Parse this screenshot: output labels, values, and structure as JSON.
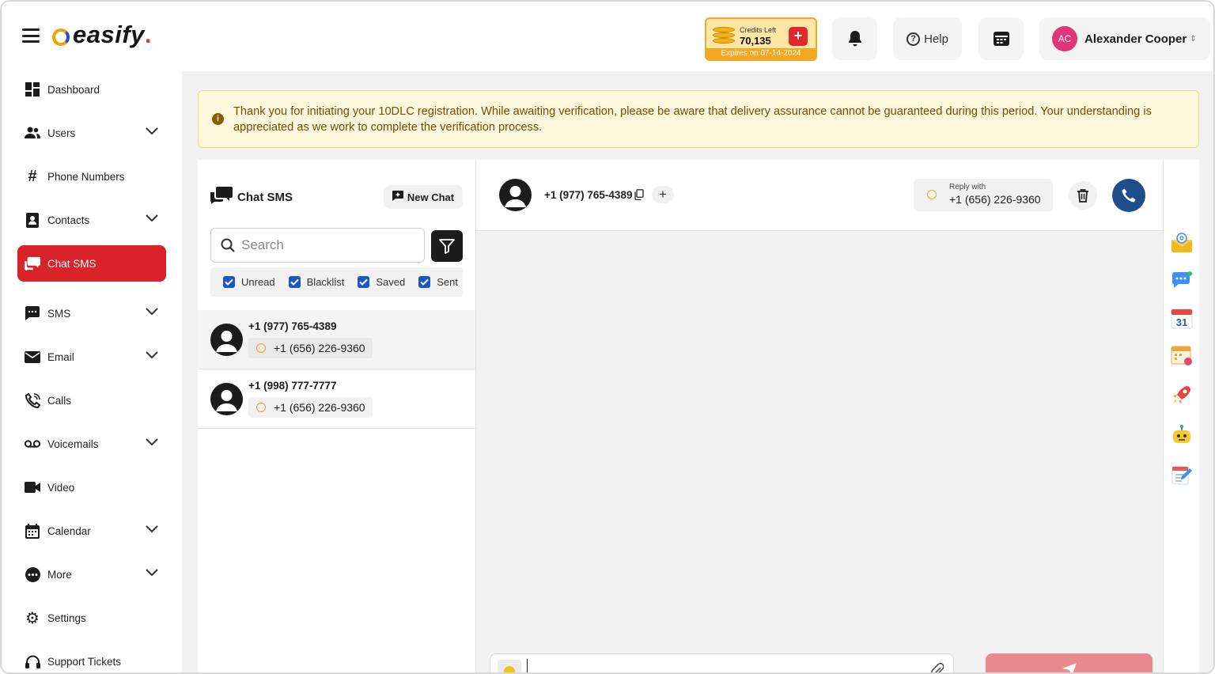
{
  "header": {
    "logo_text": "easify",
    "logo_dot": ".",
    "credits": {
      "label": "Credits Left",
      "value": "70,135",
      "expires": "Expires on 07-14-2024",
      "add": "+"
    },
    "help_label": "Help",
    "help_q": "?",
    "user": {
      "initials": "AC",
      "name": "Alexander Cooper"
    }
  },
  "sidebar": {
    "items": [
      {
        "label": "Dashboard",
        "icon": "dashboard-icon",
        "expandable": false
      },
      {
        "label": "Users",
        "icon": "users-icon",
        "expandable": true
      },
      {
        "label": "Phone Numbers",
        "icon": "hash-icon",
        "expandable": false
      },
      {
        "label": "Contacts",
        "icon": "contacts-icon",
        "expandable": true
      },
      {
        "label": "Chat SMS",
        "icon": "chat-icon",
        "expandable": false,
        "active": true
      },
      {
        "label": "SMS",
        "icon": "sms-icon",
        "expandable": true
      },
      {
        "label": "Email",
        "icon": "email-icon",
        "expandable": true
      },
      {
        "label": "Calls",
        "icon": "phone-icon",
        "expandable": false
      },
      {
        "label": "Voicemails",
        "icon": "voicemail-icon",
        "expandable": true
      },
      {
        "label": "Video",
        "icon": "video-icon",
        "expandable": false
      },
      {
        "label": "Calendar",
        "icon": "calendar-icon",
        "expandable": true
      },
      {
        "label": "More",
        "icon": "more-icon",
        "expandable": true
      },
      {
        "label": "Settings",
        "icon": "gear-icon",
        "expandable": false
      },
      {
        "label": "Support Tickets",
        "icon": "headset-icon",
        "expandable": false
      }
    ]
  },
  "banner": {
    "info": "i",
    "message": "Thank you for initiating your 10DLC registration. While awaiting verification, please be aware that delivery assurance cannot be guaranteed during this period. Your understanding is appreciated as we work to complete the verification process."
  },
  "chat_list": {
    "title": "Chat SMS",
    "new_chat_label": "New Chat",
    "search_placeholder": "Search",
    "filters": [
      {
        "label": "Unread",
        "checked": true
      },
      {
        "label": "Blacklist",
        "checked": true
      },
      {
        "label": "Saved",
        "checked": true
      },
      {
        "label": "Sent",
        "checked": true
      }
    ],
    "conversations": [
      {
        "number": "+1 (977) 765-4389",
        "via": "+1 (656) 226-9360",
        "selected": true
      },
      {
        "number": "+1 (998) 777-7777",
        "via": "+1 (656) 226-9360",
        "selected": false
      }
    ]
  },
  "conversation": {
    "number": "+1 (977) 765-4389",
    "add_label": "+",
    "reply_label": "Reply with",
    "reply_number": "+1 (656) 226-9360",
    "message_value": "",
    "message_placeholder": ""
  },
  "colors": {
    "accent": "#d8232a",
    "call_button": "#1f4f8b",
    "checkbox": "#1a56c4",
    "banner_bg": "#fff8dc",
    "credits_bg": "#fde6a6"
  },
  "right_rail": [
    "mail-at-icon",
    "chat-bubble-icon",
    "calendar-31-icon",
    "calendar-event-icon",
    "rocket-icon",
    "bot-icon",
    "notes-icon"
  ]
}
